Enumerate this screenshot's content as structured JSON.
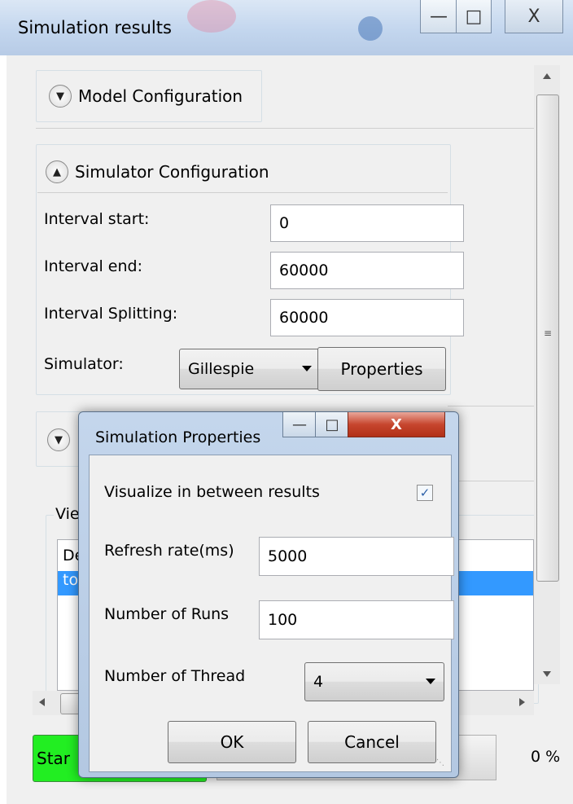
{
  "window": {
    "title": "Simulation results",
    "minimize_glyph": "—",
    "maximize_glyph": "□",
    "close_glyph": "X"
  },
  "sections": {
    "model": {
      "header": "Model Configuration",
      "expand_icon": "chevron-down"
    },
    "simulator": {
      "header": "Simulator Configuration",
      "expand_icon": "chevron-up"
    },
    "third": {
      "expand_icon": "chevron-down"
    }
  },
  "simulator_config": {
    "interval_start_label": "Interval start:",
    "interval_start_value": "0",
    "interval_end_label": "Interval end:",
    "interval_end_value": "60000",
    "interval_splitting_label": "Interval Splitting:",
    "interval_splitting_value": "60000",
    "simulator_label": "Simulator:",
    "simulator_value": "Gillespie",
    "properties_button": "Properties"
  },
  "view_panel": {
    "group_label_partial": "Vie",
    "list_items_partial": [
      "De",
      "to"
    ]
  },
  "bottom": {
    "start_button_partial": "Star",
    "progress_value": "0 %"
  },
  "dialog": {
    "title": "Simulation Properties",
    "visualize_label": "Visualize in between results",
    "visualize_checked": true,
    "refresh_rate_label": "Refresh rate(ms)",
    "refresh_rate_value": "5000",
    "num_runs_label": "Number of Runs",
    "num_runs_value": "100",
    "num_thread_label": "Number of Thread",
    "num_thread_value": "4",
    "ok_button": "OK",
    "cancel_button": "Cancel",
    "minimize_glyph": "—",
    "maximize_glyph": "□",
    "close_glyph": "X"
  },
  "colors": {
    "selection": "#3399ff",
    "start_button": "#22ee22",
    "dialog_close": "#c7462e"
  }
}
